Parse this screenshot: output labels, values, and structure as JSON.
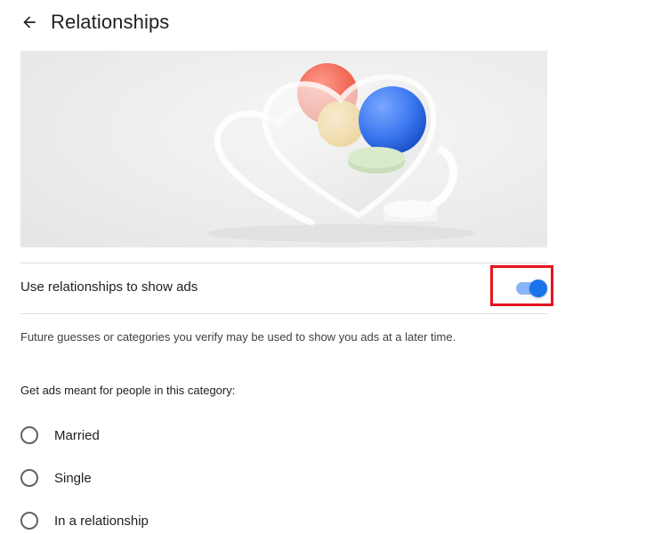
{
  "header": {
    "back_icon": "arrow-left-icon",
    "title": "Relationships"
  },
  "hero": {
    "image": "relationships-illustration-heart"
  },
  "ads_setting": {
    "label": "Use relationships to show ads",
    "enabled": true,
    "toggle_color": "#1a73e8",
    "highlight_color": "#e3151f"
  },
  "info": {
    "text": "Future guesses or categories you verify may be used to show you ads at a later time."
  },
  "category": {
    "label": "Get ads meant for people in this category:",
    "options": [
      {
        "label": "Married",
        "selected": false
      },
      {
        "label": "Single",
        "selected": false
      },
      {
        "label": "In a relationship",
        "selected": false
      }
    ]
  }
}
